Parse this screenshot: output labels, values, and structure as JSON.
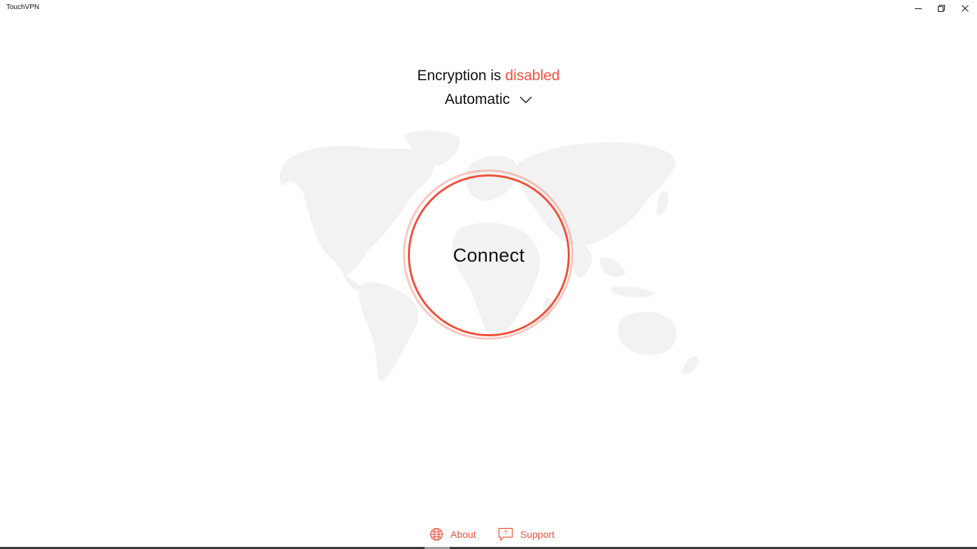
{
  "window": {
    "title": "TouchVPN",
    "controls": {
      "minimize_icon": "minimize-icon",
      "restore_icon": "restore-icon",
      "close_icon": "close-icon"
    }
  },
  "status": {
    "prefix": "Encryption is",
    "state": "disabled",
    "state_color": "#f0503a"
  },
  "location": {
    "selected": "Automatic",
    "icon": "chevron-down-icon"
  },
  "connect": {
    "label": "Connect",
    "ring_color": "#f0503a"
  },
  "footer": {
    "about": {
      "label": "About",
      "icon": "globe-icon"
    },
    "support": {
      "label": "Support",
      "icon": "chat-question-icon"
    }
  },
  "colors": {
    "accent": "#f0503a",
    "map": "#f2f2f2",
    "background": "#ffffff"
  }
}
